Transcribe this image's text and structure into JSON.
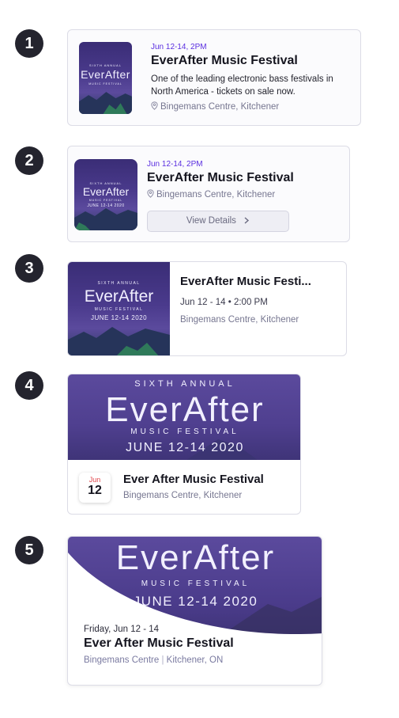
{
  "poster": {
    "annual": "SIXTH ANNUAL",
    "brand": "EverAfter",
    "tagline": "MUSIC FESTIVAL",
    "dates": "JUNE 12-14 2020"
  },
  "card1": {
    "number": "1",
    "date": "Jun 12-14, 2PM",
    "title": "EverAfter Music Festival",
    "description": "One of the leading electronic bass festivals in North America - tickets on sale now.",
    "location": "Bingemans Centre, Kitchener"
  },
  "card2": {
    "number": "2",
    "date": "Jun 12-14, 2PM",
    "title": "EverAfter Music Festival",
    "location": "Bingemans Centre, Kitchener",
    "button": "View Details"
  },
  "card3": {
    "number": "3",
    "title": "EverAfter Music Festi...",
    "datetime": "Jun 12 - 14 • 2:00 PM",
    "location": "Bingemans Centre, Kitchener"
  },
  "card4": {
    "number": "4",
    "month": "Jun",
    "day": "12",
    "title": "Ever After Music Festival",
    "location": "Bingemans Centre, Kitchener"
  },
  "card5": {
    "number": "5",
    "date": "Friday, Jun 12 - 14",
    "title": "Ever After Music Festival",
    "venue": "Bingemans Centre",
    "separator": "|",
    "city": "Kitchener, ON"
  }
}
